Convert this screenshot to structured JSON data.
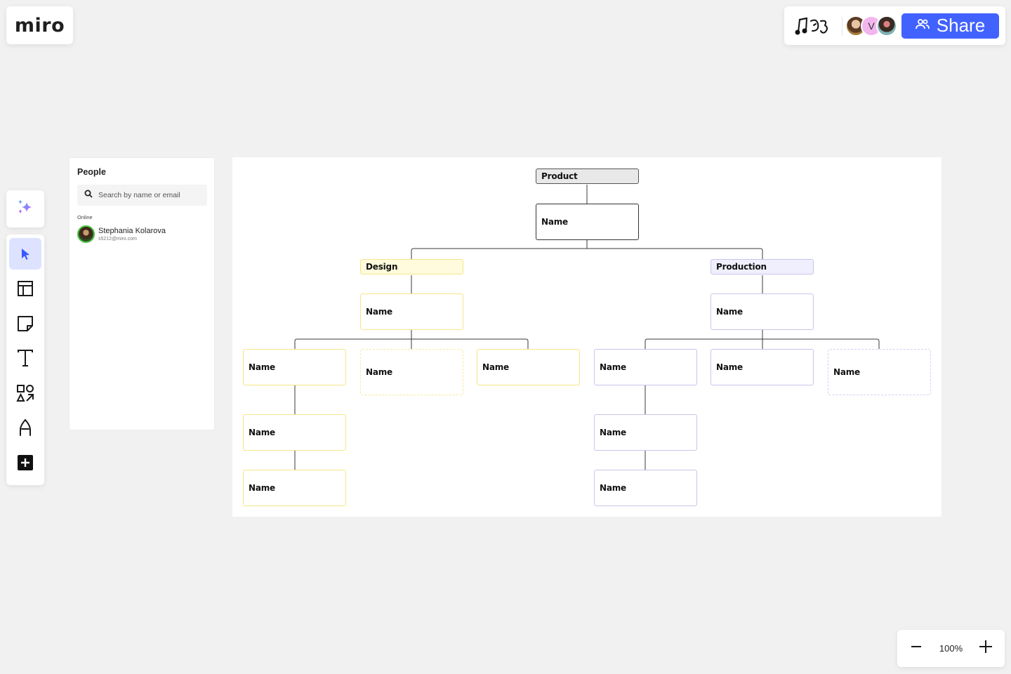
{
  "app": {
    "logo": "miro"
  },
  "collab": {
    "board_emoji_icon": "music-notes-doodle",
    "avatars": [
      {
        "kind": "photo",
        "label": ""
      },
      {
        "kind": "initial",
        "label": "V"
      },
      {
        "kind": "photo",
        "label": ""
      }
    ],
    "share_label": "Share",
    "share_icon": "people-icon",
    "accent": "#4262ff"
  },
  "toolbar": {
    "ai_icon": "sparkles-icon",
    "tools": [
      {
        "name": "select",
        "icon": "cursor-icon",
        "active": true
      },
      {
        "name": "templates",
        "icon": "layout-icon",
        "active": false
      },
      {
        "name": "sticky-note",
        "icon": "sticky-note-icon",
        "active": false
      },
      {
        "name": "text",
        "icon": "text-icon",
        "active": false
      },
      {
        "name": "shapes",
        "icon": "shapes-icon",
        "active": false
      },
      {
        "name": "pen",
        "icon": "pen-icon",
        "active": false
      },
      {
        "name": "more",
        "icon": "plus-square-icon",
        "active": false
      }
    ]
  },
  "people": {
    "title": "People",
    "search_placeholder": "Search by name or email",
    "search_value": "",
    "online_label": "Online",
    "users": [
      {
        "name": "Stephania Kolarova",
        "email": "s5212@miro.com",
        "status_color": "#4cc23f"
      }
    ]
  },
  "org_chart": {
    "root": {
      "title": "Product",
      "name": "Name"
    },
    "departments": [
      {
        "title": "Design",
        "lead": "Name",
        "color": "#f6e58a",
        "members": [
          {
            "name": "Name",
            "reports": [
              "Name",
              "Name"
            ]
          },
          {
            "name": "Name",
            "placeholder": true
          },
          {
            "name": "Name"
          }
        ]
      },
      {
        "title": "Production",
        "lead": "Name",
        "color": "#c9c3ef",
        "members": [
          {
            "name": "Name",
            "reports": [
              "Name",
              "Name"
            ]
          },
          {
            "name": "Name"
          },
          {
            "name": "Name",
            "placeholder": true
          }
        ]
      }
    ]
  },
  "zoom": {
    "value": "100%",
    "zoom_out_icon": "minus-icon",
    "zoom_in_icon": "plus-icon"
  }
}
